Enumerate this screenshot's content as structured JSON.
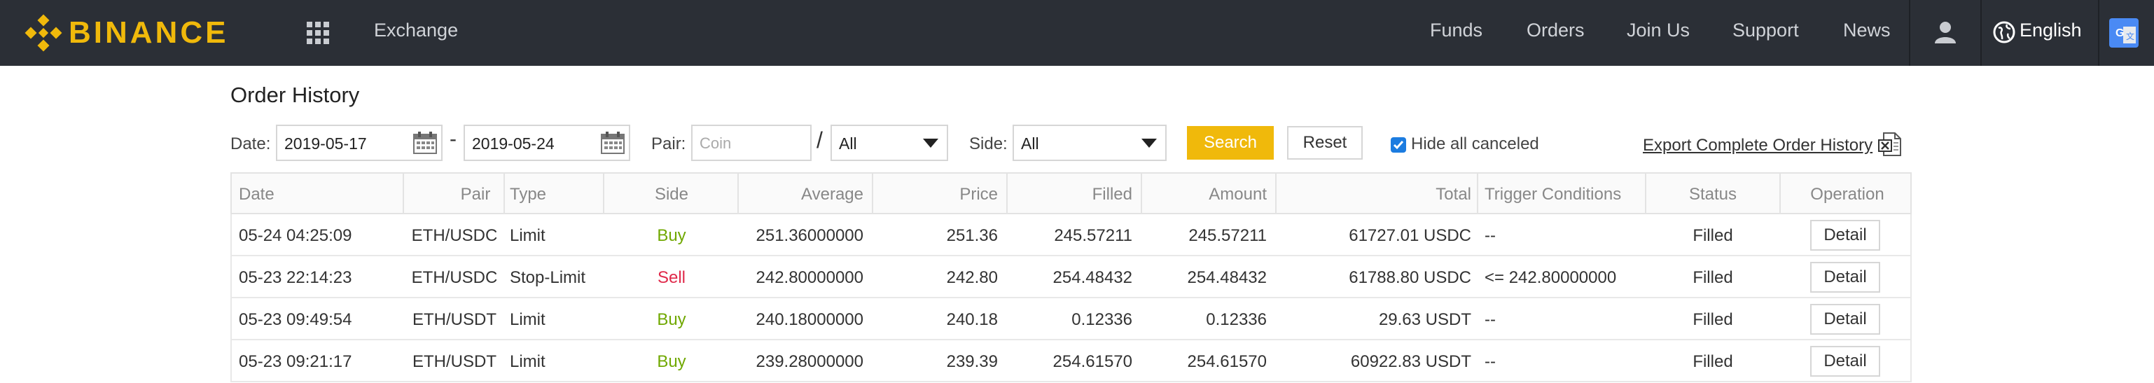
{
  "nav": {
    "logo_text": "BINANCE",
    "exchange": "Exchange",
    "items": [
      "Funds",
      "Orders",
      "Join Us",
      "Support",
      "News"
    ],
    "language": "English"
  },
  "page": {
    "title": "Order History"
  },
  "filters": {
    "date_label": "Date:",
    "date_from": "2019-05-17",
    "date_to": "2019-05-24",
    "date_separator": "-",
    "pair_label": "Pair:",
    "coin_placeholder": "Coin",
    "pair_separator": "/",
    "quote_value": "All",
    "side_label": "Side:",
    "side_value": "All",
    "search_label": "Search",
    "reset_label": "Reset",
    "hide_canceled_label": "Hide all canceled",
    "hide_canceled_checked": true,
    "export_label": "Export Complete Order History"
  },
  "table": {
    "headers": [
      "Date",
      "Pair",
      "Type",
      "Side",
      "Average",
      "Price",
      "Filled",
      "Amount",
      "Total",
      "Trigger Conditions",
      "Status",
      "Operation"
    ],
    "rows": [
      {
        "date": "05-24 04:25:09",
        "pair": "ETH/USDC",
        "type": "Limit",
        "side": "Buy",
        "average": "251.36000000",
        "price": "251.36",
        "filled": "245.57211",
        "amount": "245.57211",
        "total": "61727.01 USDC",
        "trigger": "--",
        "status": "Filled",
        "operation": "Detail"
      },
      {
        "date": "05-23 22:14:23",
        "pair": "ETH/USDC",
        "type": "Stop-Limit",
        "side": "Sell",
        "average": "242.80000000",
        "price": "242.80",
        "filled": "254.48432",
        "amount": "254.48432",
        "total": "61788.80 USDC",
        "trigger": "<= 242.80000000",
        "status": "Filled",
        "operation": "Detail"
      },
      {
        "date": "05-23 09:49:54",
        "pair": "ETH/USDT",
        "type": "Limit",
        "side": "Buy",
        "average": "240.18000000",
        "price": "240.18",
        "filled": "0.12336",
        "amount": "0.12336",
        "total": "29.63 USDT",
        "trigger": "--",
        "status": "Filled",
        "operation": "Detail"
      },
      {
        "date": "05-23 09:21:17",
        "pair": "ETH/USDT",
        "type": "Limit",
        "side": "Buy",
        "average": "239.28000000",
        "price": "239.39",
        "filled": "254.61570",
        "amount": "254.61570",
        "total": "60922.83 USDT",
        "trigger": "--",
        "status": "Filled",
        "operation": "Detail"
      }
    ]
  },
  "colors": {
    "brand": "#f0b90b",
    "nav_bg": "#2b2f36",
    "buy": "#70a800",
    "sell": "#e0294a"
  }
}
